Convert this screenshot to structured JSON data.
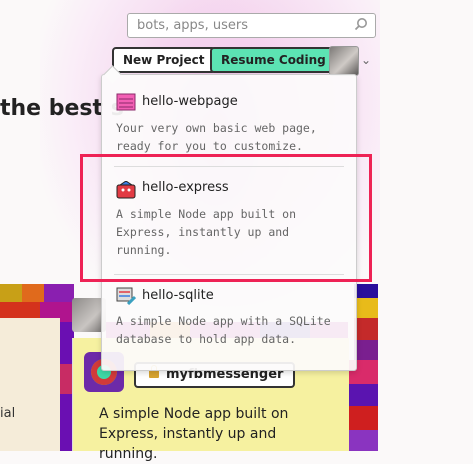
{
  "header": {
    "search_placeholder": "bots, apps, users",
    "new_project_label": "New Project",
    "resume_coding_label": "Resume Coding",
    "chevron": "⌄"
  },
  "hero": {
    "headline": "the best s"
  },
  "dropdown": {
    "items": [
      {
        "title": "hello-webpage",
        "description": "Your very own basic web page, ready for you to customize."
      },
      {
        "title": "hello-express",
        "description": "A simple Node app built on Express, instantly up and running."
      },
      {
        "title": "hello-sqlite",
        "description": "A simple Node app with a SQLite database to hold app data."
      }
    ]
  },
  "left_card": {
    "partial_text": "ial"
  },
  "project_card": {
    "name": "myfbmessenger",
    "description": "A simple Node app built on Express, instantly up and running."
  },
  "colors": {
    "accent": "#5ce3b3",
    "highlight": "#ee2255",
    "card": "#f6f1a0"
  }
}
